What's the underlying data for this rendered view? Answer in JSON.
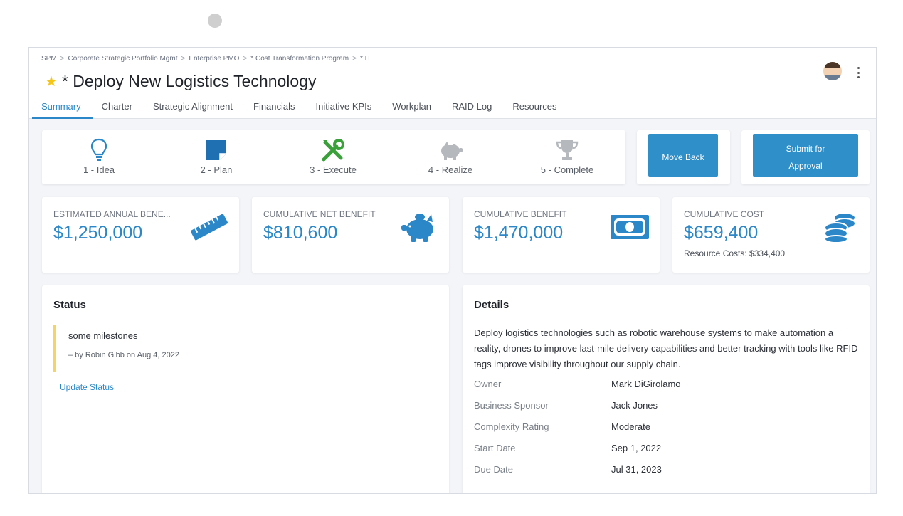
{
  "breadcrumb": [
    "SPM",
    "Corporate Strategic Portfolio Mgmt",
    "Enterprise PMO",
    "* Cost Transformation Program",
    "* IT"
  ],
  "title": "* Deploy New Logistics Technology",
  "tabs": [
    "Summary",
    "Charter",
    "Strategic Alignment",
    "Financials",
    "Initiative KPIs",
    "Workplan",
    "RAID Log",
    "Resources"
  ],
  "active_tab": "Summary",
  "stages": [
    {
      "label": "1 - Idea",
      "icon": "lightbulb-icon"
    },
    {
      "label": "2 - Plan",
      "icon": "note-icon"
    },
    {
      "label": "3 - Execute",
      "icon": "tools-icon"
    },
    {
      "label": "4 - Realize",
      "icon": "piggy-bank-icon"
    },
    {
      "label": "5 - Complete",
      "icon": "trophy-icon"
    }
  ],
  "actions": {
    "move_back": "Move Back",
    "submit": "Submit for Approval"
  },
  "kpis": [
    {
      "label": "ESTIMATED ANNUAL BENE...",
      "value": "$1,250,000",
      "icon": "ruler-icon"
    },
    {
      "label": "CUMULATIVE NET BENEFIT",
      "value": "$810,600",
      "icon": "piggy-bank-icon"
    },
    {
      "label": "CUMULATIVE BENEFIT",
      "value": "$1,470,000",
      "icon": "cash-icon"
    },
    {
      "label": "CUMULATIVE COST",
      "value": "$659,400",
      "sub": "Resource Costs: $334,400",
      "icon": "coins-icon"
    }
  ],
  "status": {
    "title": "Status",
    "message": "some milestones",
    "by": "– by Robin Gibb on Aug 4, 2022",
    "update_link": "Update Status"
  },
  "details": {
    "title": "Details",
    "description": "Deploy logistics technologies such as robotic warehouse systems to make automation a reality, drones to improve last-mile delivery capabilities and better tracking with tools like RFID tags improve visibility throughout our supply chain.",
    "rows": [
      {
        "key": "Owner",
        "value": "Mark DiGirolamo"
      },
      {
        "key": "Business Sponsor",
        "value": "Jack Jones"
      },
      {
        "key": "Complexity Rating",
        "value": "Moderate"
      },
      {
        "key": "Start Date",
        "value": "Sep 1, 2022"
      },
      {
        "key": "Due Date",
        "value": "Jul 31, 2023"
      }
    ]
  },
  "colors": {
    "accent": "#2b87c8",
    "button": "#2f8fc9",
    "execute_green": "#3aa13a",
    "status_bar": "#f6d365"
  }
}
